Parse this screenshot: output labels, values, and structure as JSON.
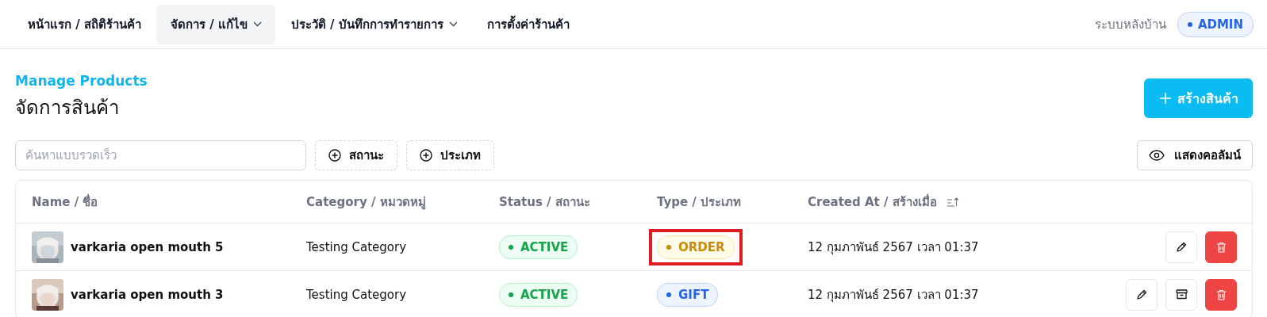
{
  "nav": {
    "items": [
      {
        "label": "หน้าแรก / สถิติร้านค้า",
        "selected": false,
        "dropdown": false
      },
      {
        "label": "จัดการ / แก้ไข",
        "selected": true,
        "dropdown": true
      },
      {
        "label": "ประวัติ / บันทึกการทำรายการ",
        "selected": false,
        "dropdown": true
      },
      {
        "label": "การตั้งค่าร้านค้า",
        "selected": false,
        "dropdown": false
      }
    ],
    "backoffice_label": "ระบบหลังบ้าน",
    "role_badge": "ADMIN"
  },
  "page": {
    "subtitle": "Manage Products",
    "title": "จัดการสินค้า",
    "create_button": "สร้างสินค้า"
  },
  "toolbar": {
    "search": {
      "placeholder": "ค้นหาแบบรวดเร็ว"
    },
    "filters": [
      "สถานะ",
      "ประเภท"
    ],
    "columns_button": "แสดงคอลัมน์"
  },
  "table": {
    "columns": [
      {
        "label": "Name / ชื่อ",
        "sorted": false
      },
      {
        "label": "Category / หมวดหมู่",
        "sorted": false
      },
      {
        "label": "Status / สถานะ",
        "sorted": false
      },
      {
        "label": "Type / ประเภท",
        "sorted": false
      },
      {
        "label": "Created At / สร้างเมื่อ",
        "sorted": true
      }
    ],
    "rows": [
      {
        "name": "varkaria open mouth 5",
        "category": "Testing Category",
        "status": {
          "label": "ACTIVE",
          "kind": "active"
        },
        "type": {
          "label": "ORDER",
          "kind": "order",
          "highlighted": true
        },
        "created": "12 กุมภาพันธ์ 2567 เวลา 01:37",
        "actions": [
          {
            "kind": "edit"
          },
          {
            "kind": "delete"
          }
        ]
      },
      {
        "name": "varkaria open mouth 3",
        "category": "Testing Category",
        "status": {
          "label": "ACTIVE",
          "kind": "active"
        },
        "type": {
          "label": "GIFT",
          "kind": "gift",
          "highlighted": false
        },
        "created": "12 กุมภาพันธ์ 2567 เวลา 01:37",
        "actions": [
          {
            "kind": "edit"
          },
          {
            "kind": "archive"
          },
          {
            "kind": "delete"
          }
        ]
      }
    ]
  }
}
